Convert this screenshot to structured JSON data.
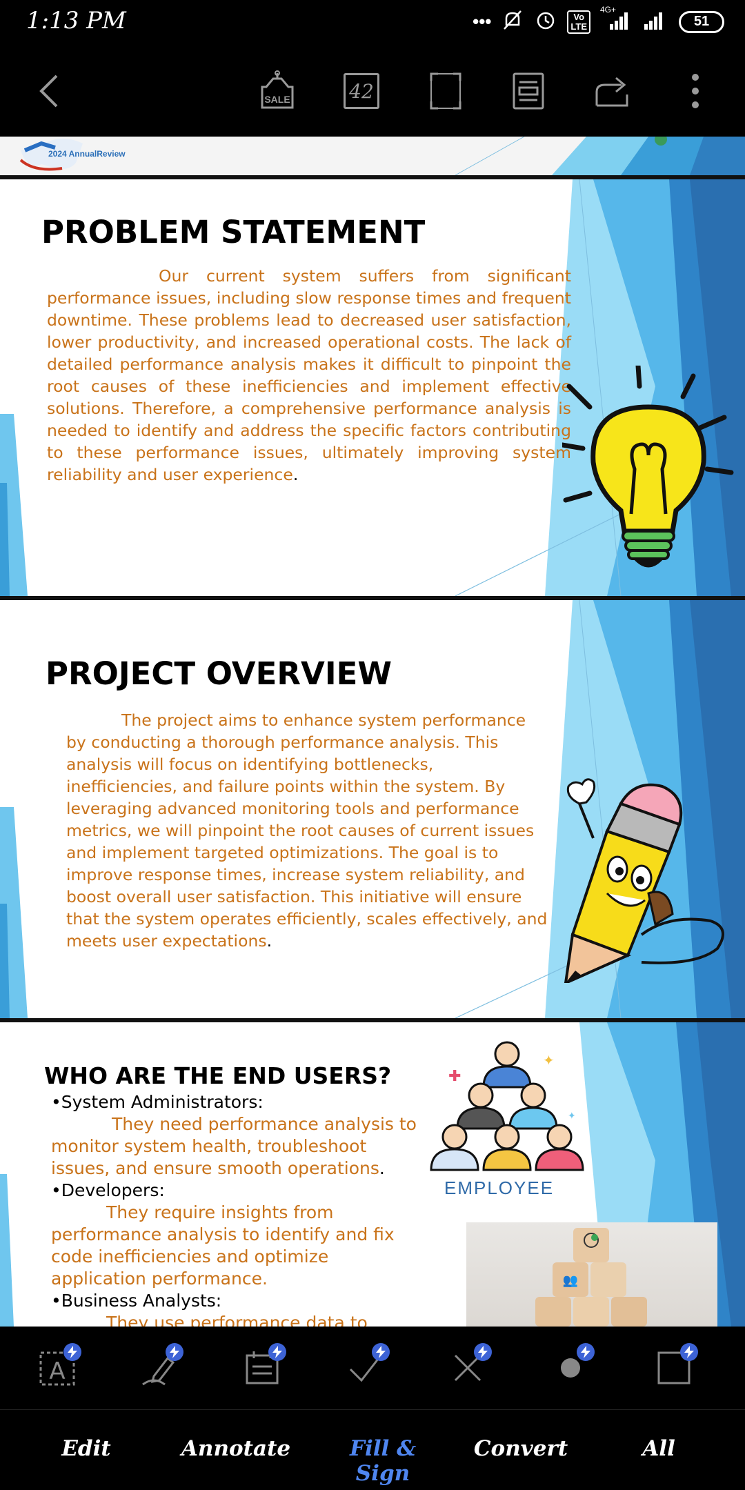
{
  "status_bar": {
    "time": "1:13 PM",
    "network": "4G+",
    "battery": "51",
    "more_indicator": "•••"
  },
  "toolbar": {
    "page_number": "42",
    "sale_label": "SALE"
  },
  "slide_top": {
    "footer_text": "2024 AnnualReview"
  },
  "slide1": {
    "title": "PROBLEM STATEMENT",
    "body": "Our current system suffers from significant performance issues, including slow response times and frequent downtime. These problems lead to decreased user satisfaction, lower productivity, and increased operational costs. The lack of detailed performance analysis makes it difficult to pinpoint the root causes of these inefficiencies and implement effective solutions. Therefore, a comprehensive performance analysis is needed to identify and address the specific factors contributing to these performance issues, ultimately improving system reliability and user experience",
    "period": "."
  },
  "slide2": {
    "title": "PROJECT OVERVIEW",
    "body": "The project aims to enhance system performance by conducting a thorough performance analysis. This analysis will focus on identifying bottlenecks, inefficiencies, and failure points within the system. By leveraging advanced monitoring tools and performance metrics, we will pinpoint the root causes of current issues and implement targeted optimizations. The goal is to improve response times, increase system reliability, and boost overall user satisfaction. This initiative will ensure that the system operates efficiently, scales effectively, and meets user expectations",
    "period": "."
  },
  "slide3": {
    "title": "WHO ARE THE END USERS?",
    "employee_label": "EMPLOYEE",
    "items": [
      {
        "heading": "•System Administrators:",
        "text": "They need performance analysis to monitor system health, troubleshoot issues, and ensure smooth operations",
        "period": "."
      },
      {
        "heading": "•Developers:",
        "text": "They require insights from performance analysis to identify and fix code inefficiencies and optimize application performance.",
        "period": ""
      },
      {
        "heading": "•Business Analysts:",
        "text": "They use performance data to assess",
        "period": ""
      }
    ]
  },
  "tools": [
    "text-box-tool",
    "signature-tool",
    "date-tool",
    "checkmark-tool",
    "cross-tool",
    "dot-tool",
    "rectangle-tool"
  ],
  "tabs": [
    {
      "label": "Edit",
      "active": false
    },
    {
      "label": "Annotate",
      "active": false
    },
    {
      "label": "Fill & Sign",
      "active": true
    },
    {
      "label": "Convert",
      "active": false
    },
    {
      "label": "All",
      "active": false
    }
  ],
  "colors": {
    "accent": "#4f86f0",
    "body_text": "#c9731a",
    "badge": "#3d63d6"
  }
}
